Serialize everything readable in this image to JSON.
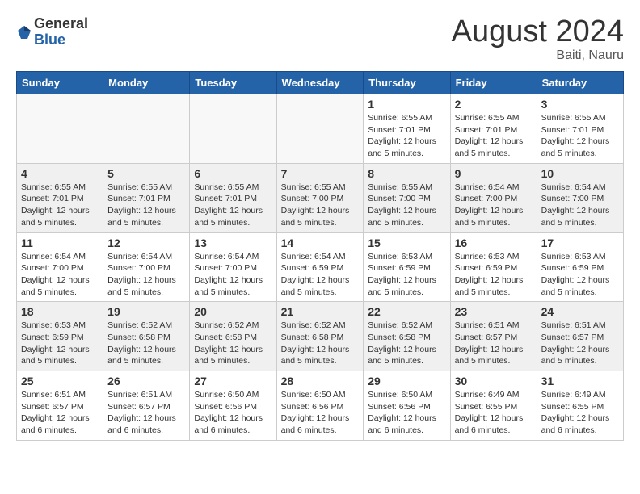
{
  "logo": {
    "general": "General",
    "blue": "Blue"
  },
  "title": "August 2024",
  "location": "Baiti, Nauru",
  "days_of_week": [
    "Sunday",
    "Monday",
    "Tuesday",
    "Wednesday",
    "Thursday",
    "Friday",
    "Saturday"
  ],
  "weeks": [
    {
      "days": [
        {
          "num": "",
          "info": ""
        },
        {
          "num": "",
          "info": ""
        },
        {
          "num": "",
          "info": ""
        },
        {
          "num": "",
          "info": ""
        },
        {
          "num": "1",
          "info": "Sunrise: 6:55 AM\nSunset: 7:01 PM\nDaylight: 12 hours\nand 5 minutes."
        },
        {
          "num": "2",
          "info": "Sunrise: 6:55 AM\nSunset: 7:01 PM\nDaylight: 12 hours\nand 5 minutes."
        },
        {
          "num": "3",
          "info": "Sunrise: 6:55 AM\nSunset: 7:01 PM\nDaylight: 12 hours\nand 5 minutes."
        }
      ]
    },
    {
      "days": [
        {
          "num": "4",
          "info": "Sunrise: 6:55 AM\nSunset: 7:01 PM\nDaylight: 12 hours\nand 5 minutes."
        },
        {
          "num": "5",
          "info": "Sunrise: 6:55 AM\nSunset: 7:01 PM\nDaylight: 12 hours\nand 5 minutes."
        },
        {
          "num": "6",
          "info": "Sunrise: 6:55 AM\nSunset: 7:01 PM\nDaylight: 12 hours\nand 5 minutes."
        },
        {
          "num": "7",
          "info": "Sunrise: 6:55 AM\nSunset: 7:00 PM\nDaylight: 12 hours\nand 5 minutes."
        },
        {
          "num": "8",
          "info": "Sunrise: 6:55 AM\nSunset: 7:00 PM\nDaylight: 12 hours\nand 5 minutes."
        },
        {
          "num": "9",
          "info": "Sunrise: 6:54 AM\nSunset: 7:00 PM\nDaylight: 12 hours\nand 5 minutes."
        },
        {
          "num": "10",
          "info": "Sunrise: 6:54 AM\nSunset: 7:00 PM\nDaylight: 12 hours\nand 5 minutes."
        }
      ]
    },
    {
      "days": [
        {
          "num": "11",
          "info": "Sunrise: 6:54 AM\nSunset: 7:00 PM\nDaylight: 12 hours\nand 5 minutes."
        },
        {
          "num": "12",
          "info": "Sunrise: 6:54 AM\nSunset: 7:00 PM\nDaylight: 12 hours\nand 5 minutes."
        },
        {
          "num": "13",
          "info": "Sunrise: 6:54 AM\nSunset: 7:00 PM\nDaylight: 12 hours\nand 5 minutes."
        },
        {
          "num": "14",
          "info": "Sunrise: 6:54 AM\nSunset: 6:59 PM\nDaylight: 12 hours\nand 5 minutes."
        },
        {
          "num": "15",
          "info": "Sunrise: 6:53 AM\nSunset: 6:59 PM\nDaylight: 12 hours\nand 5 minutes."
        },
        {
          "num": "16",
          "info": "Sunrise: 6:53 AM\nSunset: 6:59 PM\nDaylight: 12 hours\nand 5 minutes."
        },
        {
          "num": "17",
          "info": "Sunrise: 6:53 AM\nSunset: 6:59 PM\nDaylight: 12 hours\nand 5 minutes."
        }
      ]
    },
    {
      "days": [
        {
          "num": "18",
          "info": "Sunrise: 6:53 AM\nSunset: 6:59 PM\nDaylight: 12 hours\nand 5 minutes."
        },
        {
          "num": "19",
          "info": "Sunrise: 6:52 AM\nSunset: 6:58 PM\nDaylight: 12 hours\nand 5 minutes."
        },
        {
          "num": "20",
          "info": "Sunrise: 6:52 AM\nSunset: 6:58 PM\nDaylight: 12 hours\nand 5 minutes."
        },
        {
          "num": "21",
          "info": "Sunrise: 6:52 AM\nSunset: 6:58 PM\nDaylight: 12 hours\nand 5 minutes."
        },
        {
          "num": "22",
          "info": "Sunrise: 6:52 AM\nSunset: 6:58 PM\nDaylight: 12 hours\nand 5 minutes."
        },
        {
          "num": "23",
          "info": "Sunrise: 6:51 AM\nSunset: 6:57 PM\nDaylight: 12 hours\nand 5 minutes."
        },
        {
          "num": "24",
          "info": "Sunrise: 6:51 AM\nSunset: 6:57 PM\nDaylight: 12 hours\nand 5 minutes."
        }
      ]
    },
    {
      "days": [
        {
          "num": "25",
          "info": "Sunrise: 6:51 AM\nSunset: 6:57 PM\nDaylight: 12 hours\nand 6 minutes."
        },
        {
          "num": "26",
          "info": "Sunrise: 6:51 AM\nSunset: 6:57 PM\nDaylight: 12 hours\nand 6 minutes."
        },
        {
          "num": "27",
          "info": "Sunrise: 6:50 AM\nSunset: 6:56 PM\nDaylight: 12 hours\nand 6 minutes."
        },
        {
          "num": "28",
          "info": "Sunrise: 6:50 AM\nSunset: 6:56 PM\nDaylight: 12 hours\nand 6 minutes."
        },
        {
          "num": "29",
          "info": "Sunrise: 6:50 AM\nSunset: 6:56 PM\nDaylight: 12 hours\nand 6 minutes."
        },
        {
          "num": "30",
          "info": "Sunrise: 6:49 AM\nSunset: 6:55 PM\nDaylight: 12 hours\nand 6 minutes."
        },
        {
          "num": "31",
          "info": "Sunrise: 6:49 AM\nSunset: 6:55 PM\nDaylight: 12 hours\nand 6 minutes."
        }
      ]
    }
  ]
}
